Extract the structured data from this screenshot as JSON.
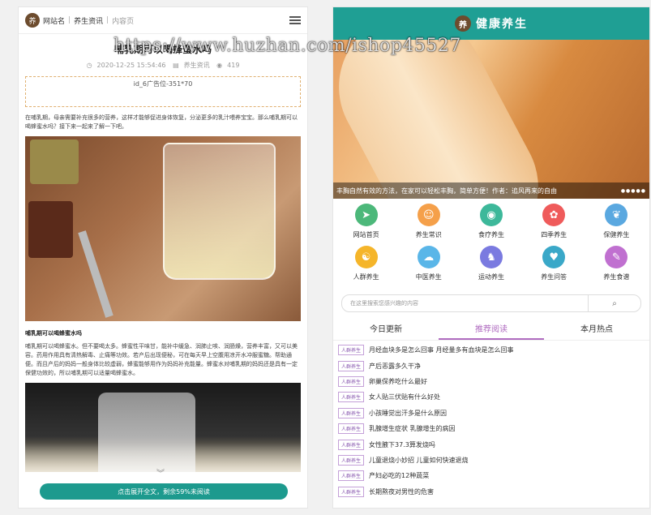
{
  "left": {
    "nav": {
      "logo_char": "养",
      "site_name": "网站名",
      "category": "养生资讯",
      "current": "内容页"
    },
    "article": {
      "title": "哺乳期可以喝蜂蜜水吗",
      "date": "2020-12-25 15:54:46",
      "category": "养生资讯",
      "views": "419",
      "ad_slot": "id_6广告位-351*70",
      "intro": "在哺乳期，母亲需要补充很多的营养，这样才能够促进身体恢复，分泌更多的乳汁喂养宝宝。那么哺乳期可以喝蜂蜜水吗？接下来一起来了解一下吧。",
      "subhead": "哺乳期可以喝蜂蜜水吗",
      "body": "哺乳期可以喝蜂蜜水。但不要喝太多。蜂蜜性平味甘，能补中缓急、润肺止咳、润肠燥，营养丰富，又可以美容。药用作用具有清热解毒、止痛等功效。若产后出现便秘，可在每天早上空腹用凉开水冲服蜜糖。帮助通便。而且产后的妈妈一般身体比较虚弱，蜂蜜能够用作为妈妈补充能量。蜂蜜水对哺乳期的妈妈还是具有一定保健功效的，所以哺乳期可以适量喝蜂蜜水。",
      "read_more": "点击展开全文，剩余59%未阅读"
    }
  },
  "right": {
    "header": {
      "seal_char": "养",
      "title": "健康养生"
    },
    "banner": {
      "caption": "丰胸自然有效的方法，在家可以轻松丰胸，简单方便！作者：追风再来的自由",
      "dots": "●●●●●"
    },
    "nav_icons": [
      {
        "label": "网站首页",
        "icon": "paper-plane-icon",
        "glyph": "➤",
        "color": "#4cb87a"
      },
      {
        "label": "养生常识",
        "icon": "person-icon",
        "glyph": "☺",
        "color": "#f5a04a"
      },
      {
        "label": "食疗养生",
        "icon": "bowl-icon",
        "glyph": "◉",
        "color": "#3db89a"
      },
      {
        "label": "四季养生",
        "icon": "flower-icon",
        "glyph": "✿",
        "color": "#ef5b5b"
      },
      {
        "label": "保健养生",
        "icon": "leaf-icon",
        "glyph": "❦",
        "color": "#5aa8e0"
      },
      {
        "label": "人群养生",
        "icon": "group-icon",
        "glyph": "☯",
        "color": "#f5b52a"
      },
      {
        "label": "中医养生",
        "icon": "cloud-icon",
        "glyph": "☁",
        "color": "#5ab6e8"
      },
      {
        "label": "运动养生",
        "icon": "runner-icon",
        "glyph": "♞",
        "color": "#7a7ae0"
      },
      {
        "label": "养生问答",
        "icon": "heart-icon",
        "glyph": "♥",
        "color": "#3aa8c8"
      },
      {
        "label": "养生食谱",
        "icon": "book-icon",
        "glyph": "✎",
        "color": "#c070d0"
      }
    ],
    "search": {
      "placeholder": "在这里搜索您感兴趣的内容"
    },
    "tabs": [
      "今日更新",
      "推荐阅读",
      "本月热点"
    ],
    "active_tab": 1,
    "news": [
      {
        "badge": "人群养生",
        "title": "月经血块多是怎么回事 月经量多有血块是怎么回事"
      },
      {
        "badge": "人群养生",
        "title": "产后恶露多久干净"
      },
      {
        "badge": "人群养生",
        "title": "卵巢保养吃什么最好"
      },
      {
        "badge": "人群养生",
        "title": "女人贴三伏贴有什么好处"
      },
      {
        "badge": "人群养生",
        "title": "小孩睡觉出汗多是什么原因"
      },
      {
        "badge": "人群养生",
        "title": "乳腺增生症状 乳腺增生的病因"
      },
      {
        "badge": "人群养生",
        "title": "女性腋下37.3算发烧吗"
      },
      {
        "badge": "人群养生",
        "title": "儿童退烧小妙招 儿童如何快速退烧"
      },
      {
        "badge": "人群养生",
        "title": "产妇必吃的12种蔬菜"
      },
      {
        "badge": "人群养生",
        "title": "长期熬夜对男性的危害"
      }
    ]
  },
  "watermark": "https://www.huzhan.com/ishop45527"
}
